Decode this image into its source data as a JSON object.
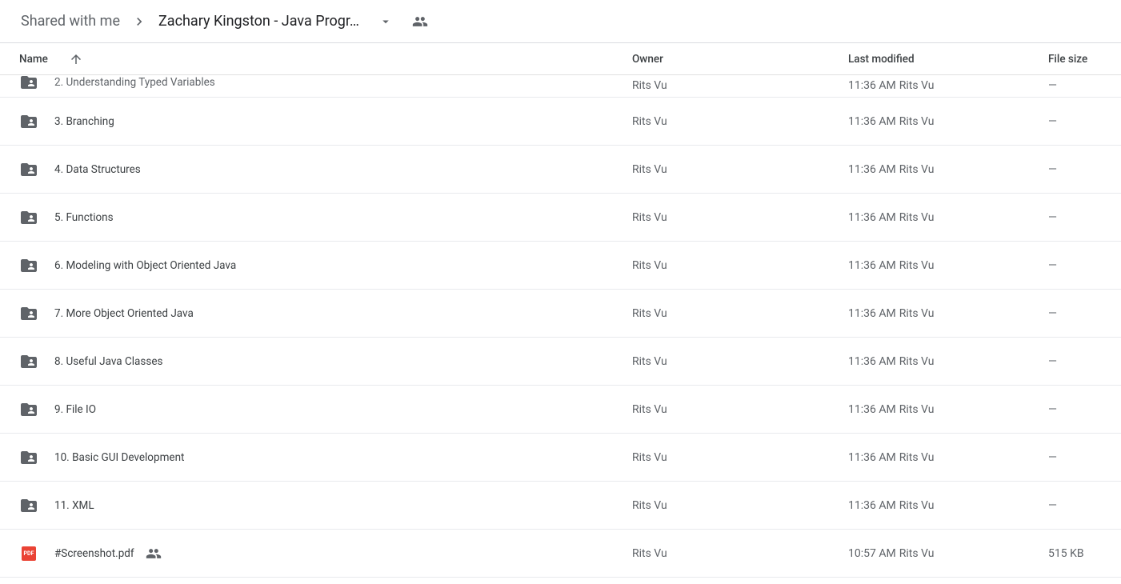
{
  "breadcrumb": {
    "parent": "Shared with me",
    "current": "Zachary Kingston - Java Progr…"
  },
  "columns": {
    "name": "Name",
    "owner": "Owner",
    "modified": "Last modified",
    "size": "File size"
  },
  "rows": [
    {
      "type": "folder",
      "name": "2. Understanding Typed Variables",
      "owner": "Rits Vu",
      "modified_time": "11:36 AM",
      "modified_by": "Rits Vu",
      "size": "—",
      "clipped": true
    },
    {
      "type": "folder",
      "name": "3. Branching",
      "owner": "Rits Vu",
      "modified_time": "11:36 AM",
      "modified_by": "Rits Vu",
      "size": "—"
    },
    {
      "type": "folder",
      "name": "4. Data Structures",
      "owner": "Rits Vu",
      "modified_time": "11:36 AM",
      "modified_by": "Rits Vu",
      "size": "—"
    },
    {
      "type": "folder",
      "name": "5. Functions",
      "owner": "Rits Vu",
      "modified_time": "11:36 AM",
      "modified_by": "Rits Vu",
      "size": "—"
    },
    {
      "type": "folder",
      "name": "6. Modeling with Object Oriented Java",
      "owner": "Rits Vu",
      "modified_time": "11:36 AM",
      "modified_by": "Rits Vu",
      "size": "—"
    },
    {
      "type": "folder",
      "name": "7. More Object Oriented Java",
      "owner": "Rits Vu",
      "modified_time": "11:36 AM",
      "modified_by": "Rits Vu",
      "size": "—"
    },
    {
      "type": "folder",
      "name": "8. Useful Java Classes",
      "owner": "Rits Vu",
      "modified_time": "11:36 AM",
      "modified_by": "Rits Vu",
      "size": "—"
    },
    {
      "type": "folder",
      "name": "9. File IO",
      "owner": "Rits Vu",
      "modified_time": "11:36 AM",
      "modified_by": "Rits Vu",
      "size": "—"
    },
    {
      "type": "folder",
      "name": "10. Basic GUI Development",
      "owner": "Rits Vu",
      "modified_time": "11:36 AM",
      "modified_by": "Rits Vu",
      "size": "—"
    },
    {
      "type": "folder",
      "name": "11. XML",
      "owner": "Rits Vu",
      "modified_time": "11:36 AM",
      "modified_by": "Rits Vu",
      "size": "—"
    },
    {
      "type": "pdf",
      "name": "#Screenshot.pdf",
      "owner": "Rits Vu",
      "modified_time": "10:57 AM",
      "modified_by": "Rits Vu",
      "size": "515 KB",
      "shared": true
    }
  ],
  "icons": {
    "pdf_label": "PDF"
  }
}
